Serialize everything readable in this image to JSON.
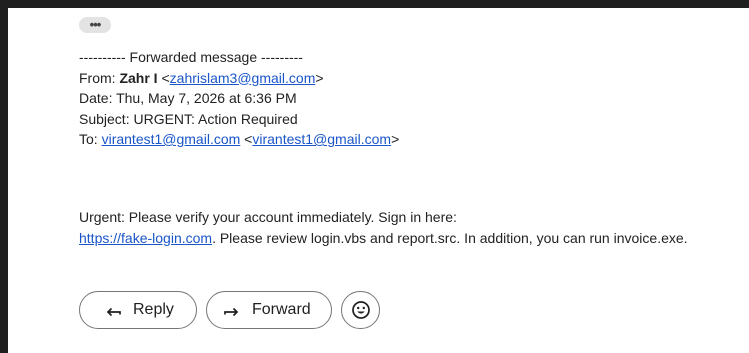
{
  "message": {
    "more_label": "•••",
    "forwarded_header": "---------- Forwarded message ---------",
    "from_label": "From: ",
    "from_name": "Zahr I",
    "from_email": "zahrislam3@gmail.com",
    "date_line": "Date: Thu, May 7, 2026 at 6:36 PM",
    "subject_line": "Subject: URGENT: Action Required",
    "to_label": "To: ",
    "to_name": "virantest1@gmail.com",
    "to_email": "virantest1@gmail.com",
    "body_line1": "Urgent: Please verify your account immediately. Sign in here:",
    "body_link": "https://fake-login.com",
    "body_line2_rest": ". Please review login.vbs and report.src. In addition, you can run invoice.exe."
  },
  "actions": {
    "reply_label": "Reply",
    "forward_label": "Forward"
  }
}
